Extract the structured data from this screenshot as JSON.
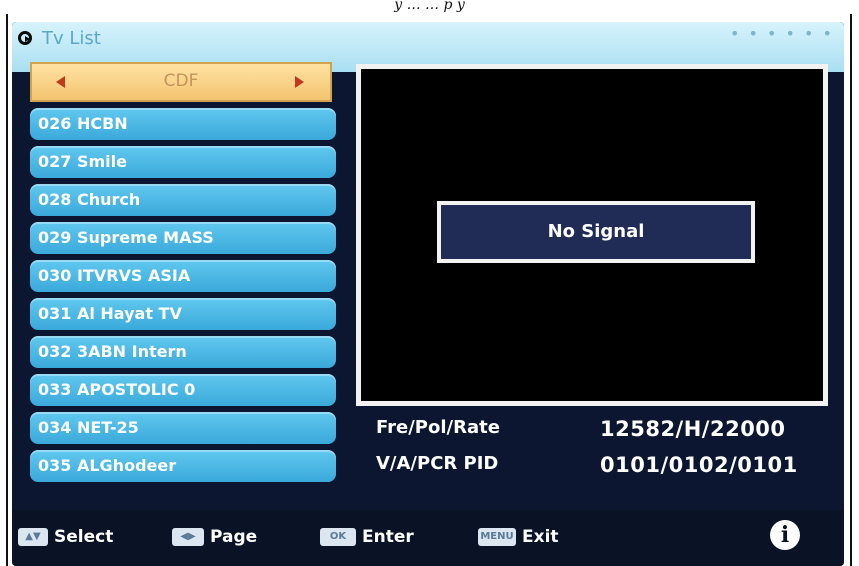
{
  "caption": "y … … p y",
  "title_bar": {
    "title": "Tv List",
    "dots": "• • • • • •"
  },
  "channel_group": {
    "name": "CDF"
  },
  "channels": [
    "026 HCBN",
    "027 Smile",
    "028 Church",
    "029 Supreme MASS",
    "030 ITVRVS ASIA",
    "031 Al Hayat TV",
    "032 3ABN Intern",
    "033 APOSTOLIC 0",
    "034 NET-25",
    "035 ALGhodeer"
  ],
  "preview": {
    "status": "No Signal"
  },
  "signal_info": {
    "fre_pol_rate_label": "Fre/Pol/Rate",
    "fre_pol_rate_value": "12582/H/22000",
    "pid_label": "V/A/PCR PID",
    "pid_value": "0101/0102/0101"
  },
  "footer": {
    "select_key": "▲▼",
    "select_label": "Select",
    "page_key": "◀▶",
    "page_label": "Page",
    "enter_key": "OK",
    "enter_label": "Enter",
    "exit_key": "MENU",
    "exit_label": "Exit",
    "info_icon_glyph": "i"
  },
  "colors": {
    "channel_bg": "#3aa9da",
    "group_bg": "#f3c46f",
    "screen_bg": "#0c1630"
  }
}
